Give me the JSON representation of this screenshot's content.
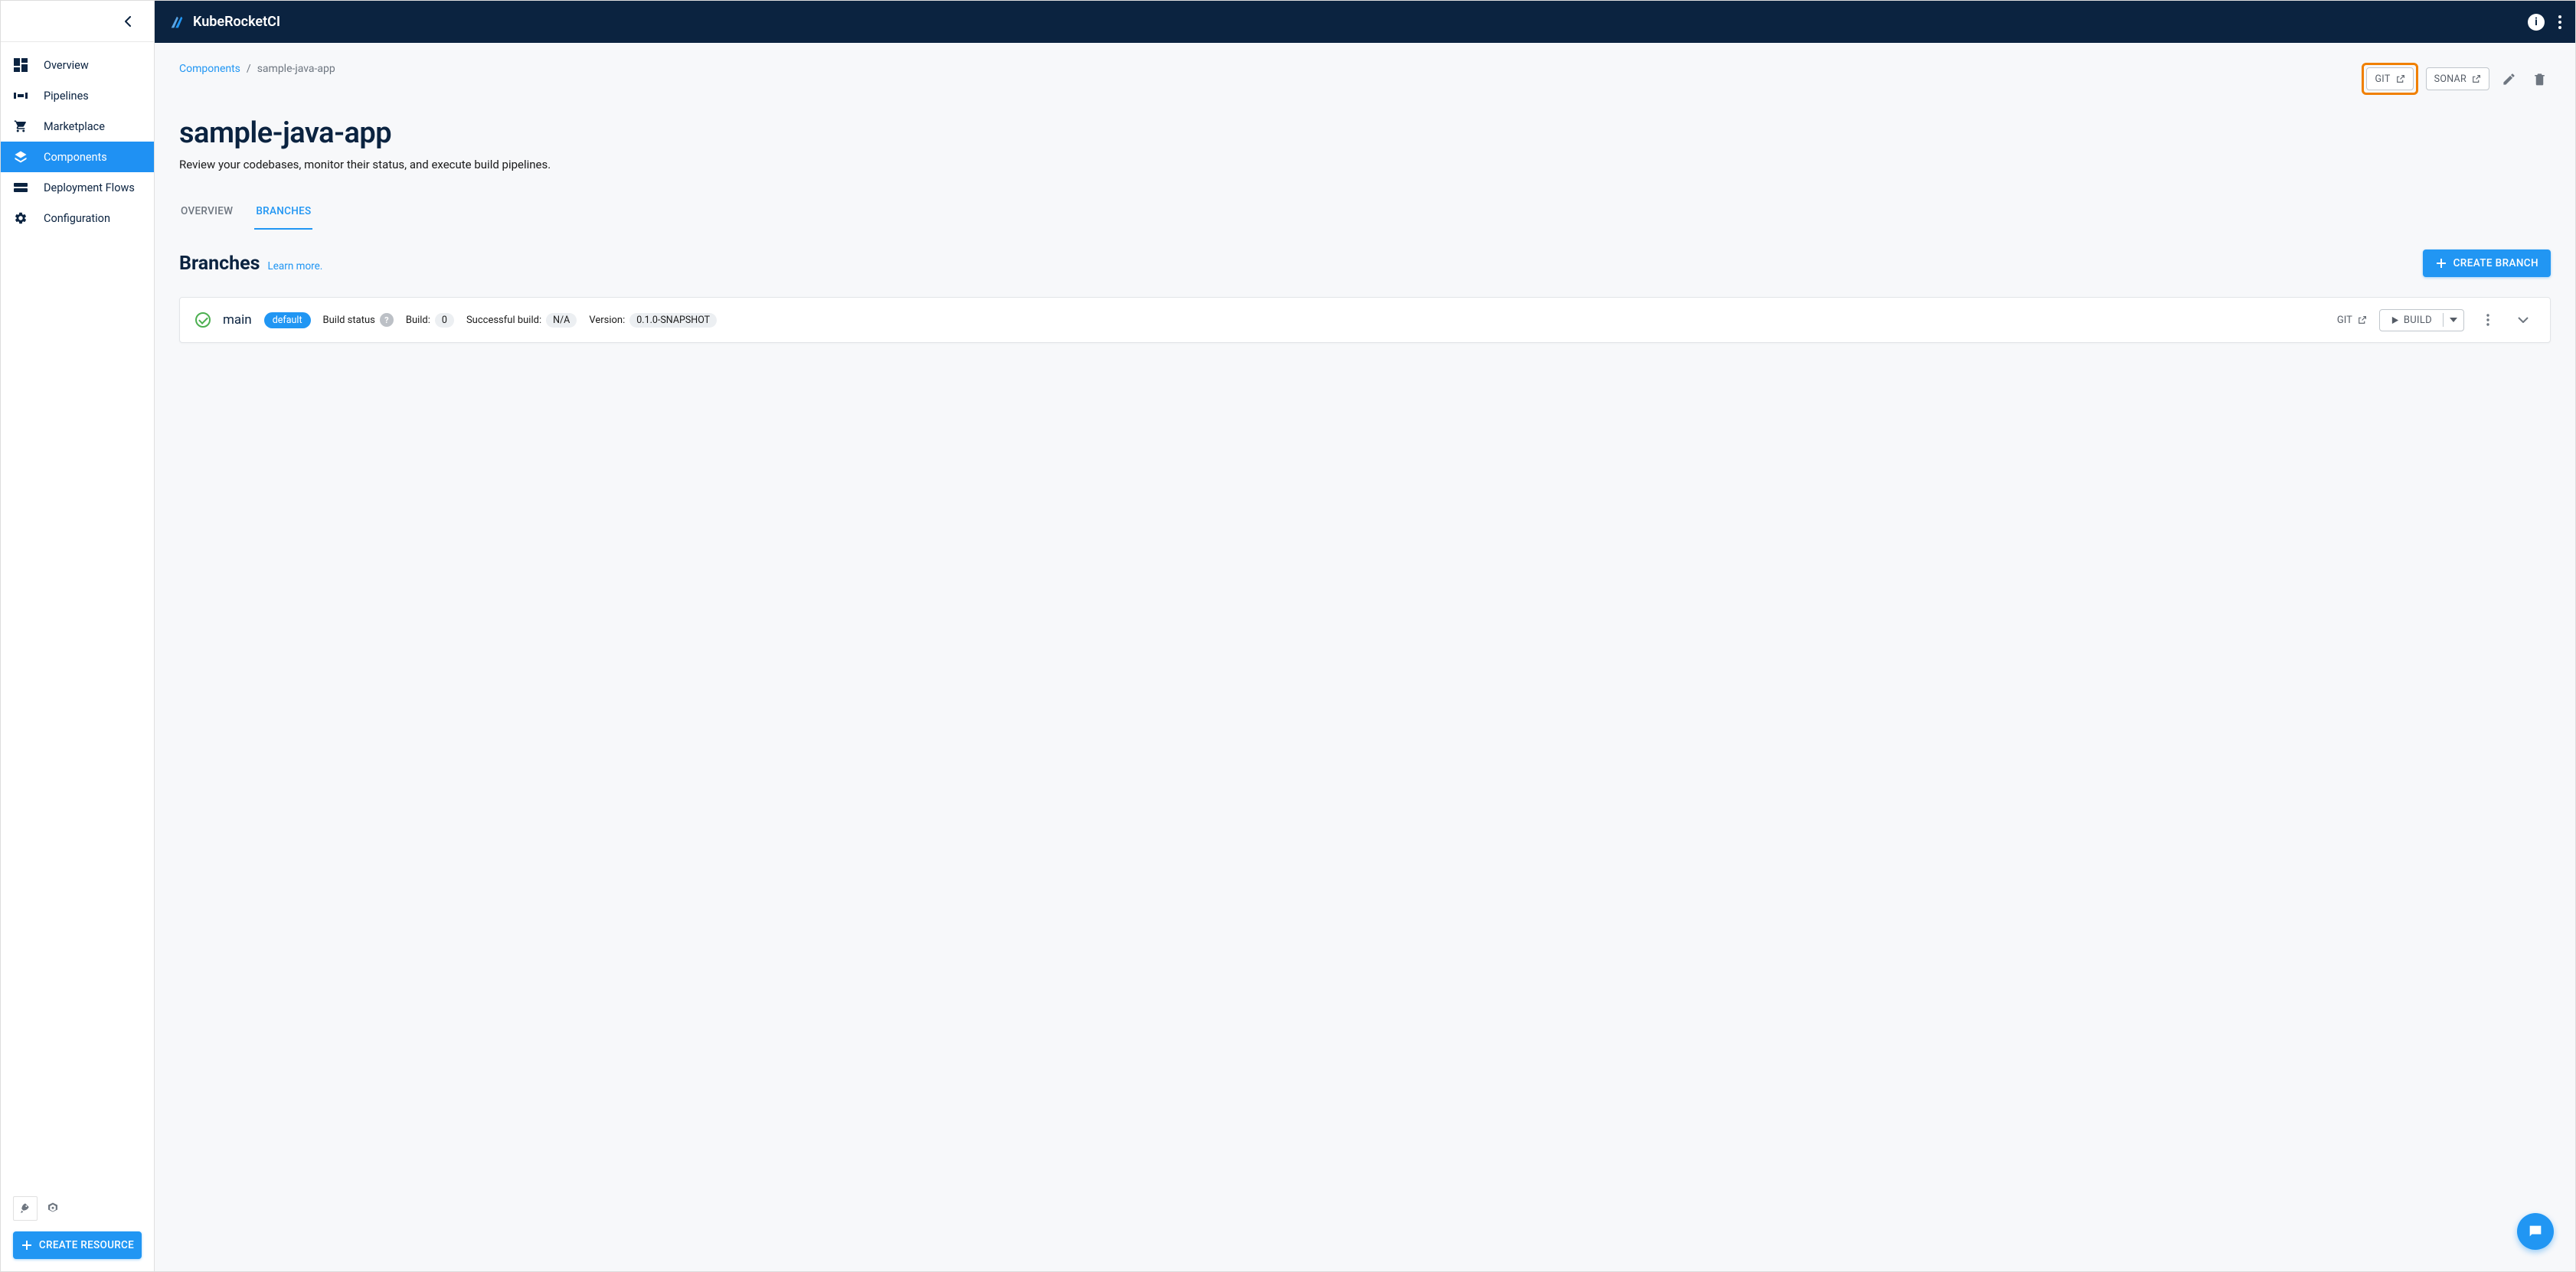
{
  "brand": "KubeRocketCI",
  "sidebar": {
    "items": [
      {
        "label": "Overview"
      },
      {
        "label": "Pipelines"
      },
      {
        "label": "Marketplace"
      },
      {
        "label": "Components"
      },
      {
        "label": "Deployment Flows"
      },
      {
        "label": "Configuration"
      }
    ],
    "create_resource_label": "CREATE RESOURCE"
  },
  "breadcrumb": {
    "root": "Components",
    "current": "sample-java-app"
  },
  "actions": {
    "git": "GIT",
    "sonar": "SONAR"
  },
  "page": {
    "title": "sample-java-app",
    "subtitle": "Review your codebases, monitor their status, and execute build pipelines."
  },
  "tabs": {
    "overview": "OVERVIEW",
    "branches": "BRANCHES"
  },
  "branches": {
    "title": "Branches",
    "learn_more": "Learn more.",
    "create_label": "CREATE BRANCH"
  },
  "branch_row": {
    "name": "main",
    "badge": "default",
    "build_status_label": "Build status",
    "build_label": "Build:",
    "build_value": "0",
    "successful_label": "Successful build:",
    "successful_value": "N/A",
    "version_label": "Version:",
    "version_value": "0.1.0-SNAPSHOT",
    "git_label": "GIT",
    "build_button": "BUILD"
  }
}
